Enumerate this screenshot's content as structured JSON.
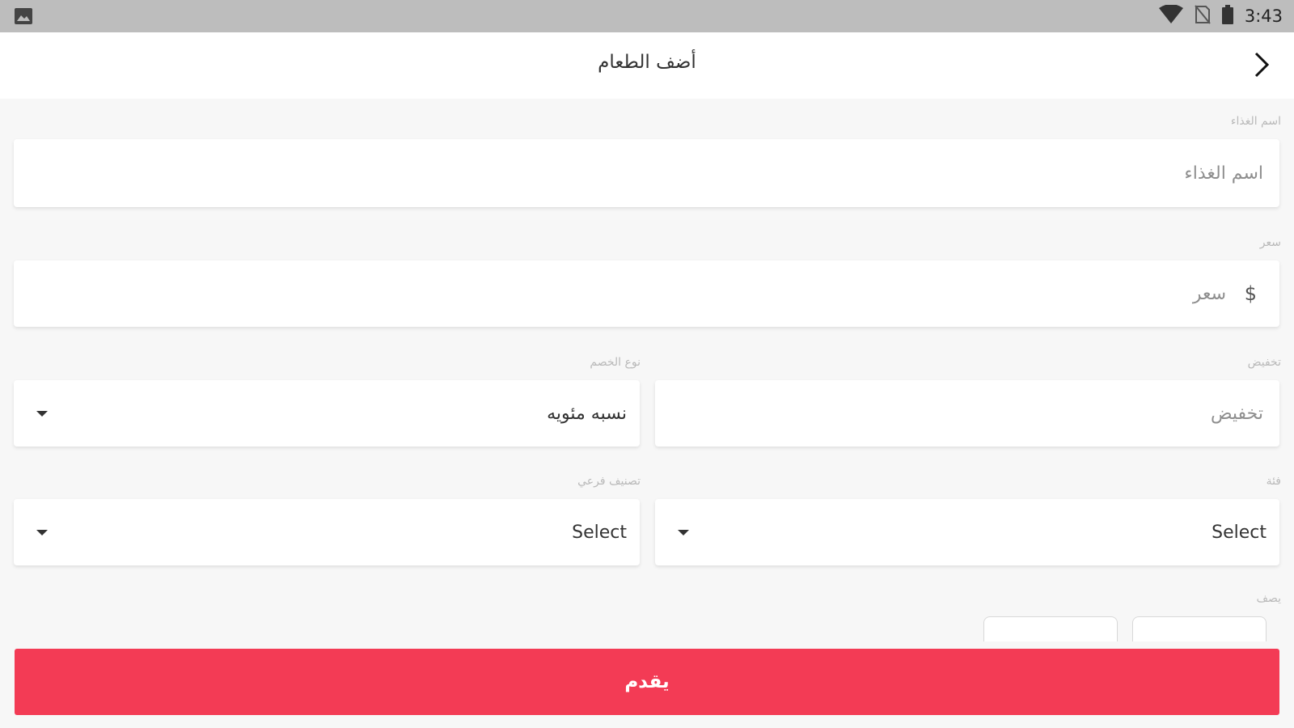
{
  "status_bar": {
    "time": "3:43",
    "icons": [
      "image-notification-icon",
      "wifi-icon",
      "no-sim-icon",
      "battery-icon"
    ]
  },
  "app_bar": {
    "title": "أضف الطعام",
    "back_icon": "chevron-right-icon"
  },
  "form": {
    "food_name": {
      "label": "اسم الغذاء",
      "placeholder": "اسم الغذاء"
    },
    "price": {
      "label": "سعر",
      "placeholder": "سعر",
      "currency_symbol": "$"
    },
    "discount": {
      "label": "تخفيض",
      "placeholder": "تخفيض"
    },
    "discount_type": {
      "label": "نوع الخصم",
      "value": "نسبه مئويه"
    },
    "category": {
      "label": "فئة",
      "value": "Select"
    },
    "subcategory": {
      "label": "تصنيف فرعي",
      "value": "Select"
    },
    "description": {
      "label": "يصف"
    }
  },
  "submit": {
    "label": "يقدم"
  },
  "colors": {
    "accent": "#f33b55",
    "status_bar": "#bdbdbd",
    "background": "#f7f7f7"
  }
}
